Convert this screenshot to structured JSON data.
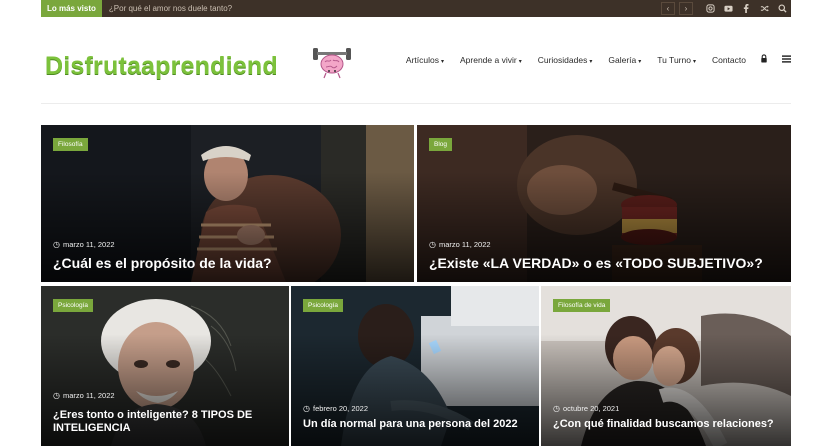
{
  "topbar": {
    "badge": "Lo más visto",
    "ticker": "¿Por qué el amor nos duele tanto?",
    "prev": "‹",
    "next": "›",
    "icons": [
      "instagram-icon",
      "youtube-icon",
      "facebook-icon",
      "shuffle-icon",
      "search-icon"
    ]
  },
  "header": {
    "logo_text": "Disfrutaaprendiend",
    "nav": [
      {
        "label": "Artículos",
        "dropdown": true
      },
      {
        "label": "Aprende a vivir",
        "dropdown": true
      },
      {
        "label": "Curiosidades",
        "dropdown": true
      },
      {
        "label": "Galería",
        "dropdown": true
      },
      {
        "label": "Tu Turno",
        "dropdown": true
      },
      {
        "label": "Contacto",
        "dropdown": false
      }
    ],
    "caret": "▾",
    "lock_icon": "lock-icon",
    "menu_icon": "hamburger-menu-icon"
  },
  "cards": [
    {
      "category": "Filosofía",
      "date": "marzo 11, 2022",
      "title": "¿Cuál es el propósito de la vida?",
      "theme": "old-man-dark"
    },
    {
      "category": "Blog",
      "date": "marzo 11, 2022",
      "title": "¿Existe «LA VERDAD» o es «TODO SUBJETIVO»?",
      "theme": "gavel"
    },
    {
      "category": "Psicología",
      "date": "marzo 11, 2022",
      "title": "¿Eres tonto o inteligente? 8 TIPOS DE INTELIGENCIA",
      "theme": "einstein"
    },
    {
      "category": "Psicología",
      "date": "febrero 20, 2022",
      "title": "Un día normal para una persona del 2022",
      "theme": "phone-bed"
    },
    {
      "category": "Filosofía de vida",
      "date": "octubre 20, 2021",
      "title": "¿Con qué finalidad buscamos relaciones?",
      "theme": "couple"
    }
  ],
  "colors": {
    "topbar_bg": "#3d3128",
    "accent_green": "#7aa73c",
    "logo_green": "#7cc23b"
  }
}
